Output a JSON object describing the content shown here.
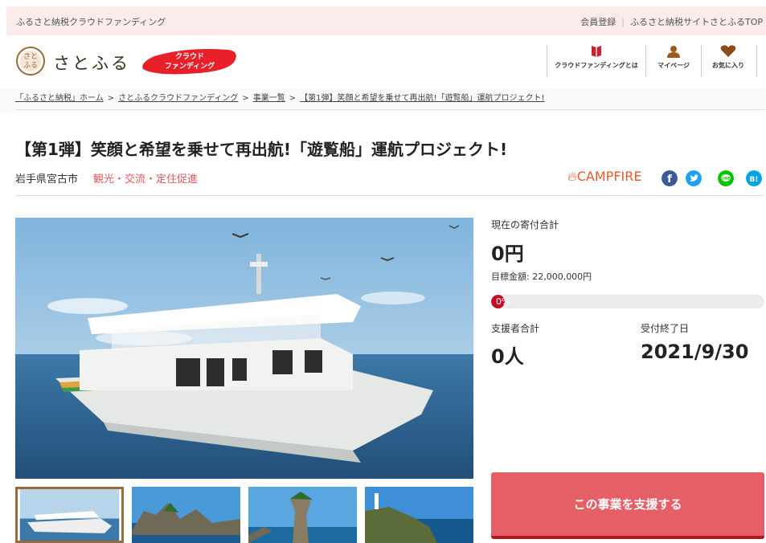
{
  "topbar": {
    "left_text": "ふるさと納税クラウドファンディング",
    "register": "会員登録",
    "site_link": "ふるさと納税サイトさとふるTOP"
  },
  "header": {
    "logo_text": "さとふる",
    "badge_line1": "クラウド",
    "badge_line2": "ファンディング",
    "nav": [
      {
        "label": "クラウドファンディングとは",
        "icon": "book-icon"
      },
      {
        "label": "マイページ",
        "icon": "user-icon"
      },
      {
        "label": "お気に入り",
        "icon": "heart-icon"
      }
    ]
  },
  "breadcrumb": {
    "items": [
      "「ふるさと納税」ホーム",
      "さとふるクラウドファンディング",
      "事業一覧",
      "【第1弾】笑顔と希望を乗せて再出航!「遊覧船」運航プロジェクト!"
    ],
    "separator": ">"
  },
  "project": {
    "title": "【第1弾】笑顔と希望を乗せて再出航!「遊覧船」運航プロジェクト!",
    "location": "岩手県宮古市",
    "category": "観光・交流・定住促進",
    "partner": "CAMPFIRE"
  },
  "share": [
    "facebook-icon",
    "twitter-icon",
    "line-icon",
    "hatena-icon"
  ],
  "stats": {
    "donation_label": "現在の寄付合計",
    "donation_value": "0円",
    "goal_text": "目標金額: 22,000,000円",
    "progress_text": "0%",
    "progress_fraction": 0.0,
    "supporters_label": "支援者合計",
    "supporters_value": "0人",
    "deadline_label": "受付終了日",
    "deadline_value": "2021/9/30"
  },
  "cta": {
    "label": "この事業を支援する"
  },
  "colors": {
    "accent": "#e46066",
    "progress": "#c30d23",
    "topbar_bg": "#fbebeb",
    "campfire": "#e85a29"
  }
}
